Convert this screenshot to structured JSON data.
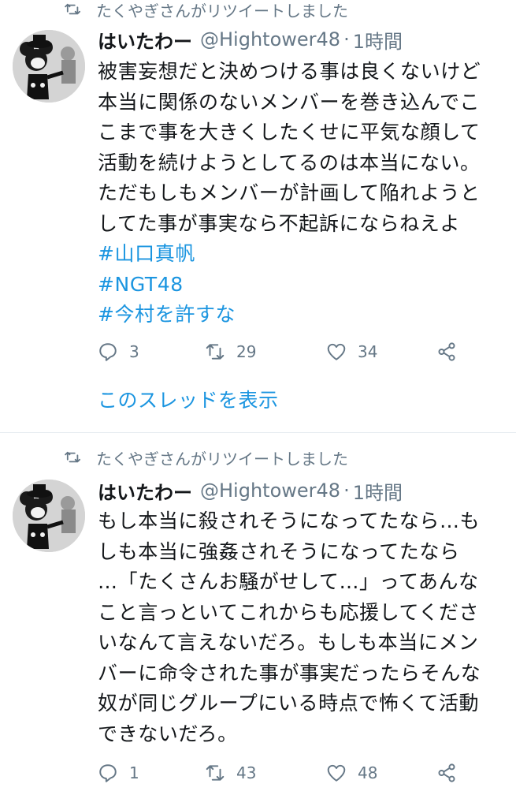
{
  "tweets": [
    {
      "retweet_notice": "たくやぎさんがリツイートしました",
      "author_name": "はいたわー",
      "handle": "@Hightower48",
      "separator": "·",
      "time": "1時間",
      "body_lines": [
        "被害妄想だと決めつける事は良くないけど",
        "本当に関係のないメンバーを巻き込んでこ",
        "こまで事を大きくしたくせに平気な顔して",
        "活動を続けようとしてるのは本当にない。",
        "ただもしもメンバーが計画して陥れようと",
        "してた事が事実なら不起訴にならねえよ"
      ],
      "hashtags": [
        "#山口真帆",
        "#NGT48",
        "#今村を許すな"
      ],
      "reply_count": "3",
      "retweet_count": "29",
      "like_count": "34",
      "thread_link": "このスレッドを表示"
    },
    {
      "retweet_notice": "たくやぎさんがリツイートしました",
      "author_name": "はいたわー",
      "handle": "@Hightower48",
      "separator": "·",
      "time": "1時間",
      "body_lines": [
        "もし本当に殺されそうになってたなら…も",
        "しも本当に強姦されそうになってたなら",
        "…「たくさんお騒がせして…」ってあんな",
        "こと言っといてこれからも応援してくださ",
        "いなんて言えないだろ。もしも本当にメン",
        "バーに命令された事が事実だったらそんな",
        "奴が同じグループにいる時点で怖くて活動",
        "できないだろ。"
      ],
      "reply_count": "1",
      "retweet_count": "43",
      "like_count": "48"
    }
  ],
  "icons": {
    "retweet_notice": "retweet-icon",
    "reply": "reply-icon",
    "retweet": "retweet-icon",
    "like": "heart-icon",
    "share": "share-icon"
  },
  "colors": {
    "link": "#1b95e0",
    "muted": "#657786",
    "text": "#14171a"
  }
}
